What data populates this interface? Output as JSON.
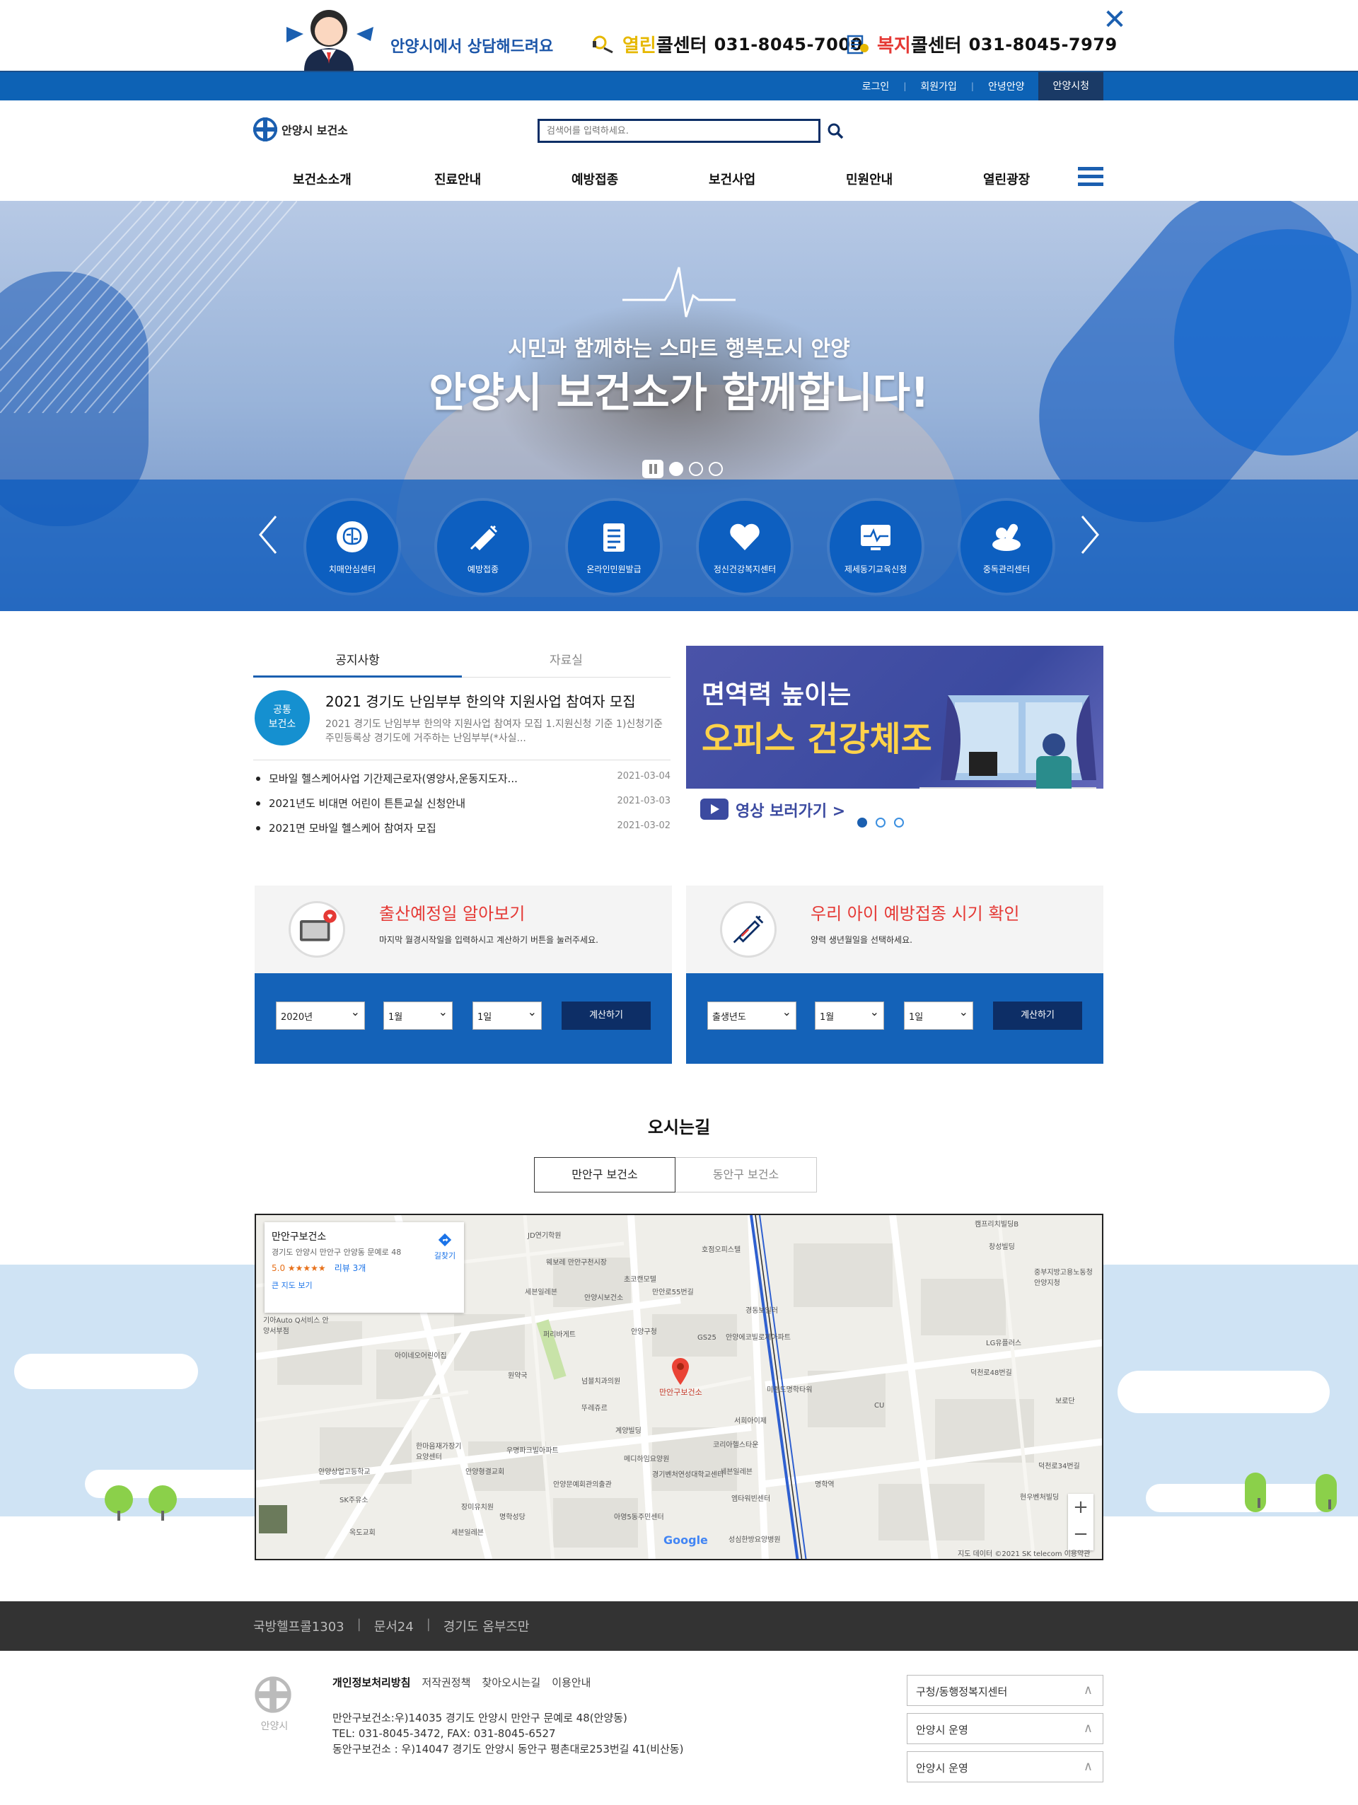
{
  "consult": {
    "title": "안양시에서 상담해드려요",
    "callcenter1_prefix": "열린",
    "callcenter1_suffix": "콜센터",
    "callcenter1_number": "031-8045-7000",
    "callcenter2_prefix": "복지",
    "callcenter2_suffix": "콜센터",
    "callcenter2_number": "031-8045-7979",
    "close": "✕"
  },
  "util": {
    "links": [
      "로그인",
      "회원가입",
      "안녕안양"
    ],
    "active": "안양시청"
  },
  "header": {
    "logo_text": "안양시 보건소",
    "search_placeholder": "검색어를 입력하세요."
  },
  "gnb": [
    "보건소소개",
    "진료안내",
    "예방접종",
    "보건사업",
    "민원안내",
    "열린광장"
  ],
  "hero": {
    "subtitle": "시민과 함께하는 스마트 행복도시 안양",
    "title": "안양시 보건소가 함께합니다!"
  },
  "quick": [
    "치매안심센터",
    "예방접종",
    "온라인민원발급",
    "정신건강복지센터",
    "제세동기교육신청",
    "중독관리센터"
  ],
  "notice": {
    "tabs": [
      "공지사항",
      "자료실"
    ],
    "featured": {
      "badge_line1": "공통",
      "badge_line2": "보건소",
      "title": "2021 경기도 난임부부 한의약 지원사업 참여자 모집",
      "desc": "2021 경기도 난임부부 한의약 지원사업 참여자 모집 1.지원신청 기준 1)신청기준 주민등록상 경기도에 거주하는 난임부부(*사실..."
    },
    "items": [
      {
        "title": "모바일 헬스케어사업 기간제근로자(영양사,운동지도자...",
        "date": "2021-03-04"
      },
      {
        "title": "2021년도 비대면 어린이 튼튼교실 신청안내",
        "date": "2021-03-03"
      },
      {
        "title": "2021면 모바일 헬스케어 참여자 모집",
        "date": "2021-03-02"
      }
    ]
  },
  "promo": {
    "line1": "면역력 높이는",
    "line2": "오피스 건강체조",
    "link": "영상 보러가기 >"
  },
  "calc1": {
    "title": "출산예정일 알아보기",
    "desc": "마지막 월경시작일을 입력하시고 계산하기 버튼을 눌러주세요.",
    "year": "2020년",
    "month": "1월",
    "day": "1일",
    "button": "계산하기"
  },
  "calc2": {
    "title": "우리 아이 예방접종 시기 확인",
    "desc": "양력 생년월일을 선택하세요.",
    "year": "출생년도",
    "month": "1월",
    "day": "1일",
    "button": "계산하기"
  },
  "directions": {
    "title": "오시는길",
    "tabs": [
      "만안구 보건소",
      "동안구 보건소"
    ]
  },
  "map": {
    "card_name": "만안구보건소",
    "card_address": "경기도 안양시 만안구 안양동 문예로 48",
    "card_rating": "5.0 ★★★★★",
    "card_reviews": "리뷰 3개",
    "card_big": "큰 지도 보기",
    "card_route": "길찾기",
    "pin_label": "만안구보건소",
    "google": "Google",
    "credit": "지도 데이터 ©2021 SK telecom    이용약관",
    "zoom_in": "+",
    "zoom_out": "−",
    "labels": [
      "JD연기학원",
      "웨보레 만안구천시장",
      "초코캔모텔",
      "안양시보건소",
      "만안로55번길",
      "안양구청",
      "퍼리바게트",
      "세븐일레븐",
      "아이네오어린이집",
      "원약국",
      "넘블치과의원",
      "뚜레쥬르",
      "계양빌딩",
      "메디하임요양원",
      "경기벤처연성대학교센터",
      "아영5동주민센터",
      "호점오피스텔",
      "경동보일러",
      "안양에코빌로제아파트",
      "미랜드명학타워",
      "서희아이제",
      "코리아헬스타운",
      "세븐일레븐",
      "엠타워빈센터",
      "CU",
      "GS25",
      "LG유플러스",
      "덕천로48번길",
      "캠프리치빌딩B",
      "창성빌딩",
      "중부지방고용노동청 안양지청",
      "덕천로34번길",
      "현우벤처빌딩",
      "보로단",
      "안양상업고등학교",
      "SK주유소",
      "옥도교회",
      "한마음재가장기요양센터",
      "안양형결교회",
      "우명파크빌아파트",
      "명학성당",
      "장미유치원",
      "세븐일레븐",
      "안양문예회관의출관",
      "성심한방요양병원",
      "기아Auto Q서비스 안양서부점",
      "명학역"
    ]
  },
  "footer": {
    "links": [
      "국방헬프콜1303",
      "문서24",
      "경기도 옴부즈만"
    ],
    "logo_text": "안양시",
    "nav": [
      "개인정보처리방침",
      "저작권정책",
      "찾아오시는길",
      "이용안내"
    ],
    "addr1": "만안구보건소:우)14035 경기도 안양시 만안구 문예로 48(안양동)",
    "addr2": "TEL: 031-8045-3472, FAX: 031-8045-6527",
    "addr3": "동안구보건소 : 우)14047 경기도 안양시 동안구 평촌대로253번길 41(비산동)",
    "selects": [
      "구청/동행정복지센터",
      "안양시 운영",
      "안양시 운영"
    ]
  },
  "colors": {
    "brand": "#0d62b5",
    "navy": "#0d2e66",
    "accent_red": "#e53935",
    "promo_purple": "#3b4aa0"
  }
}
